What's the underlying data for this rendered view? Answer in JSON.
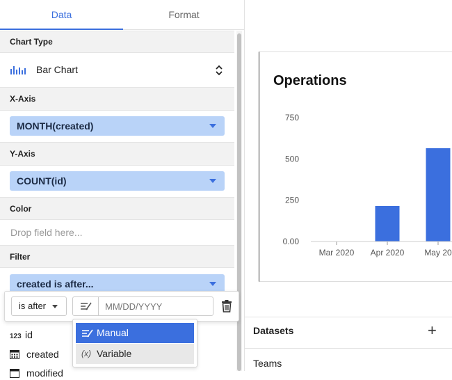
{
  "tabs": {
    "data": "Data",
    "format": "Format"
  },
  "chart_type": {
    "heading": "Chart Type",
    "value": "Bar Chart"
  },
  "x_axis": {
    "heading": "X-Axis",
    "value": "MONTH(created)"
  },
  "y_axis": {
    "heading": "Y-Axis",
    "value": "COUNT(id)"
  },
  "color": {
    "heading": "Color",
    "placeholder": "Drop field here..."
  },
  "filter": {
    "heading": "Filter",
    "value": "created is after...",
    "operator": "is after",
    "date_placeholder": "MM/DD/YYYY",
    "menu": {
      "manual": "Manual",
      "variable": "Variable",
      "variable_icon": "(x)"
    }
  },
  "fields": [
    {
      "type_icon": "123",
      "name": "id"
    },
    {
      "type_icon": "calendar-icon",
      "name": "created"
    },
    {
      "type_icon": "calendar-icon",
      "name": "modified"
    }
  ],
  "chart": {
    "title": "Operations"
  },
  "chart_data": {
    "type": "bar",
    "title": "Operations",
    "categories": [
      "Mar 2020",
      "Apr 2020",
      "May 2020"
    ],
    "x_tick_labels": [
      "Mar 2020",
      "Apr 2020",
      "May 20"
    ],
    "values": [
      0,
      215,
      565
    ],
    "y_ticks": [
      "0.00",
      "250",
      "500",
      "750"
    ],
    "ylim": [
      0,
      750
    ],
    "color": "#3b6fde",
    "grid": false
  },
  "datasets": {
    "title": "Datasets",
    "items": [
      "Teams"
    ]
  },
  "colors": {
    "accent": "#3b6fde",
    "pill": "#b9d3f8"
  }
}
